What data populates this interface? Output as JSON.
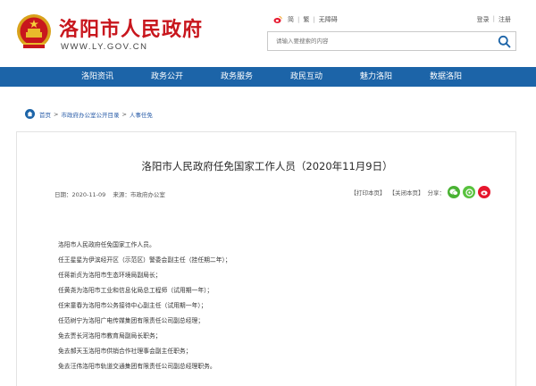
{
  "header": {
    "site_title": "洛阳市人民政府",
    "site_url": "WWW.LY.GOV.CN",
    "top_links": [
      "简",
      "繁",
      "无障碍"
    ],
    "user_links": [
      "登录",
      "注册"
    ],
    "search_placeholder": "请输入要搜索的内容"
  },
  "nav": {
    "items": [
      "洛阳资讯",
      "政务公开",
      "政务服务",
      "政民互动",
      "魅力洛阳",
      "数据洛阳"
    ]
  },
  "breadcrumb": {
    "items": [
      "首页",
      "市政府办公室公开目录",
      "人事任免"
    ],
    "separator": ">"
  },
  "article": {
    "title": "洛阳市人民政府任免国家工作人员（2020年11月9日）",
    "date": "日期：2020-11-09",
    "source": "来源：市政府办公室",
    "print_label": "【打印本页】",
    "close_label": "【关闭本页】",
    "share_label": "分享：",
    "paragraphs": [
      "洛阳市人民政府任免国家工作人员。",
      "任王星星为伊滨经开区（示范区）警委会副主任（挂任期二年）；",
      "任蒋新贞为洛阳市生态环境局副局长；",
      "任黄尧为洛阳市工业和信息化局总工程师（试用期一年）；",
      "任宋童春为洛阳市公务接待中心副主任（试用期一年）；",
      "任范树宁为洛阳广电传媒集团有限责任公司副总经理；",
      "免去贾长河洛阳市教育局副局长职务；",
      "免去郝天玉洛阳市供销合作社理事会副主任职务；",
      "免去汪伟洛阳市轨道交通集团有限责任公司副总经理职务。"
    ]
  },
  "colors": {
    "brand_red": "#c8161d",
    "nav_blue": "#1c64a8",
    "link_blue": "#2a5da8"
  },
  "icons": {
    "emblem": "national-emblem-icon",
    "weibo": "weibo-icon",
    "search": "search-icon",
    "home": "home-icon",
    "share": [
      "wechat-icon",
      "moments-icon",
      "weibo-icon"
    ]
  }
}
